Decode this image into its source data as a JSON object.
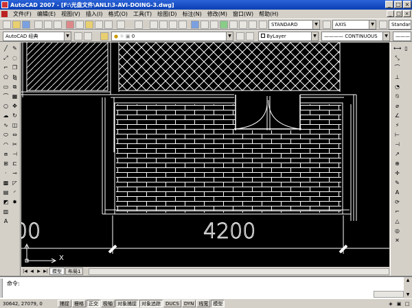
{
  "window": {
    "title": "AutoCAD 2007 - [F:\\光盘文件\\ANLI\\3-AVI-DOING-3.dwg]",
    "minimize": "_",
    "maximize": "□",
    "close": "×"
  },
  "menu": [
    "文件(F)",
    "编辑(E)",
    "视图(V)",
    "插入(I)",
    "格式(O)",
    "工具(T)",
    "绘图(D)",
    "标注(N)",
    "修改(M)",
    "窗口(W)",
    "帮助(H)"
  ],
  "toolbar": {
    "text_style": "STANDARD",
    "dim_style": "AXIS",
    "table_style": "Standard",
    "workspace": "AutoCAD 经典",
    "layer": "0",
    "color": "ByLayer",
    "linetype": "CONTINUOUS"
  },
  "drawing": {
    "dimension_main": "4200",
    "dimension_partial": "00",
    "ucs_label": "X"
  },
  "tabs": {
    "nav": [
      "|◀",
      "◀",
      "▶",
      "▶|"
    ],
    "items": [
      "模型",
      "布局1"
    ]
  },
  "command": {
    "prompt": "命令:",
    "scroll_up": "▲",
    "scroll_down": "▼"
  },
  "status": {
    "coordinates": "30642, 27079, 0",
    "buttons": [
      {
        "label": "捕捉",
        "on": false
      },
      {
        "label": "栅格",
        "on": false
      },
      {
        "label": "正交",
        "on": true
      },
      {
        "label": "极轴",
        "on": false
      },
      {
        "label": "对象捕捉",
        "on": true
      },
      {
        "label": "对象追踪",
        "on": true
      },
      {
        "label": "DUCS",
        "on": false
      },
      {
        "label": "DYN",
        "on": false
      },
      {
        "label": "线宽",
        "on": false
      },
      {
        "label": "模型",
        "on": true
      }
    ]
  }
}
